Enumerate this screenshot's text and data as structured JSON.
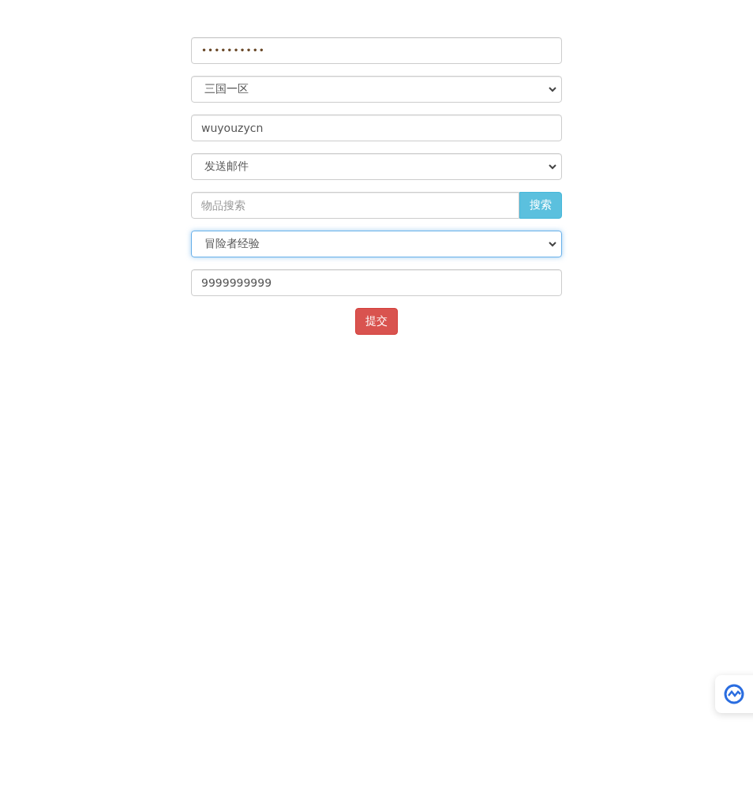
{
  "fields": [
    {
      "kind": "password",
      "value": "••••••••••",
      "focused": false
    },
    {
      "kind": "select",
      "value": "三国一区",
      "focused": false
    },
    {
      "kind": "text",
      "value": "wuyouzycn",
      "focused": false
    },
    {
      "kind": "select",
      "value": "发送邮件",
      "focused": false
    },
    {
      "kind": "search",
      "placeholder": "物品搜索",
      "button": "搜索",
      "focused": false
    },
    {
      "kind": "select",
      "value": "冒险者经验",
      "focused": true
    },
    {
      "kind": "text",
      "value": "9999999999",
      "focused": false
    }
  ],
  "submit": "提交"
}
